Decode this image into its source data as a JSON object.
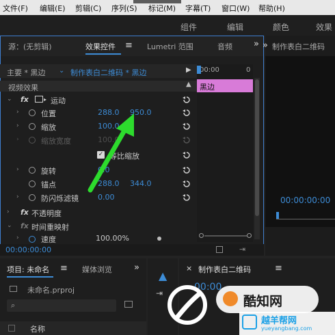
{
  "menubar": {
    "items": [
      "文件(F)",
      "编辑(E)",
      "剪辑(C)",
      "序列(S)",
      "标记(M)",
      "字幕(T)",
      "窗口(W)",
      "帮助(H)"
    ]
  },
  "workspace": {
    "tabs": [
      "组件",
      "编辑",
      "颜色",
      "效果"
    ]
  },
  "effect_controls": {
    "tabs": [
      "源：(无剪辑)",
      "效果控件",
      "Lumetri 范围",
      "音频"
    ],
    "more": "»",
    "menu_glyph": "≡",
    "master_label": "主要 * 黑边",
    "sequence_label": "制作表白二维码 * 黑边",
    "section_video": "视频效果",
    "fx": "fx",
    "motion": "运动",
    "position_label": "位置",
    "position_x": "288.0",
    "position_y": "950.0",
    "scale_label": "缩放",
    "scale_value": "100.0",
    "scale_width_label": "缩放宽度",
    "scale_width_value": "100.0",
    "uniform_scale_label": "等比缩放",
    "rotation_label": "旋转",
    "rotation_value": "0.0",
    "anchor_label": "锚点",
    "anchor_x": "288.0",
    "anchor_y": "344.0",
    "antiflicker_label": "防闪烁滤镜",
    "antiflicker_value": "0.00",
    "opacity_label": "不透明度",
    "time_remap_label": "时间重映射",
    "speed_label": "速度",
    "speed_value": "100.00%",
    "timecode": "00:00:00:00",
    "timeline_start": "00:00",
    "timeline_end": "0",
    "clip_label": "黑边"
  },
  "program_monitor": {
    "title": "制作表白二维码",
    "timecode": "00:00:00:00"
  },
  "project_panel": {
    "tabs": [
      "项目: 未命名",
      "媒体浏览"
    ],
    "menu_glyph": "≡",
    "more": "»",
    "file_name": "未命名.prproj",
    "name_header": "名称"
  },
  "timeline_panel": {
    "title": "制作表白二维码",
    "menu_glyph": "≡",
    "timecode": "00:00"
  },
  "watermark": {
    "text": "酷知网",
    "site": "yueyangbang.com",
    "site_cn": "越羊帮网"
  },
  "colors": {
    "accent_blue": "#3d8cd6",
    "clip_pink": "#d87bd8",
    "arrow_green": "#2ddb2d",
    "panel_border": "#3f7fd0"
  }
}
